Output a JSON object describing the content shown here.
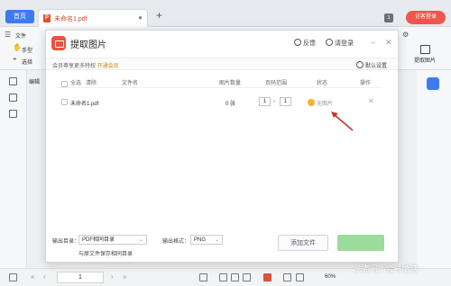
{
  "app": {
    "home_tab": "首页",
    "doc_tab": "未命名1.pdf",
    "login_button": "访客登录",
    "page_count_badge": "1",
    "menu_file": "文件",
    "tool_hand": "手型",
    "tool_select": "选择",
    "tool_edit": "编辑",
    "extract_image_btn": "提取图片",
    "page_number": "1",
    "zoom_level": "60%"
  },
  "dialog": {
    "title": "提取图片",
    "feedback": "反馈",
    "login": "请登录",
    "vip_text": "会员尊享更多特权",
    "vip_link": "开通会员",
    "default_settings": "默认设置",
    "columns": {
      "select_all": "全选",
      "clear": "清除",
      "filename": "文件名",
      "image_count": "图片数量",
      "page_range": "页码范围",
      "status": "状态",
      "action": "操作"
    },
    "rows": [
      {
        "filename": "未命名1.pdf",
        "image_count": "0 张",
        "range_from": "1",
        "range_sep": "-",
        "range_to": "1",
        "status": "无图片"
      }
    ],
    "output_dir_label": "输出目录：",
    "output_dir_value": "PDF相同目录",
    "same_source_text": "与原文件保存相同目录",
    "output_format_label": "输出格式：",
    "output_format_value": "PNG",
    "add_file_button": "添加文件"
  },
  "watermark": "头条号 / 会号情感",
  "colors": {
    "accent_blue": "#3d7bf0",
    "brand_red": "#e8533d",
    "status_yellow": "#f3b42c",
    "annotation_arrow": "#c0392b",
    "start_button_green": "#9bdc9c"
  }
}
